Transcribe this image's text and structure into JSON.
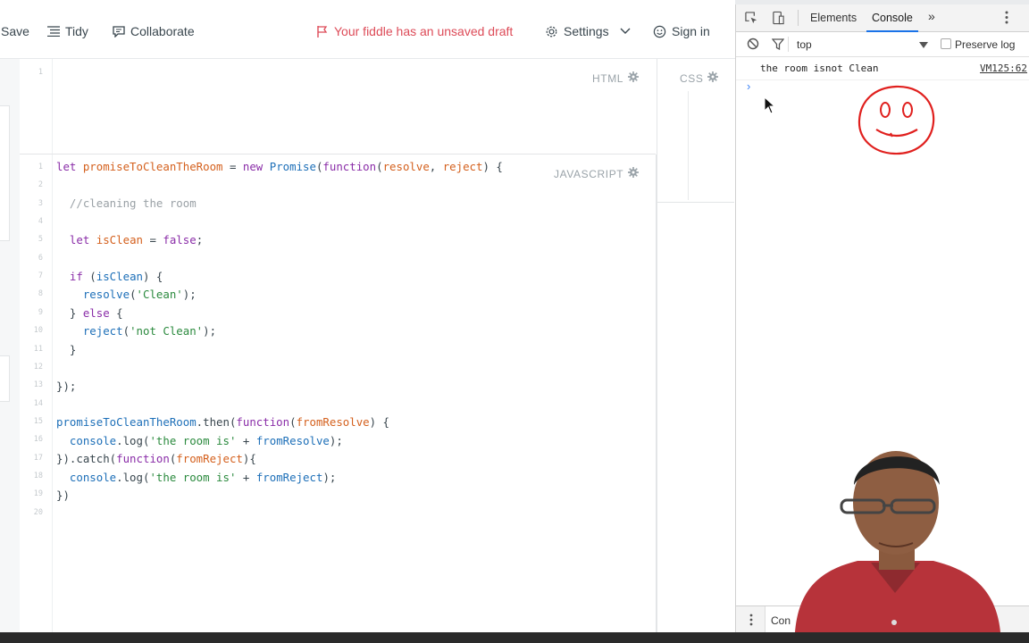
{
  "toolbar": {
    "save": "Save",
    "tidy": "Tidy",
    "collaborate": "Collaborate",
    "draft_notice": "Your fiddle has an unsaved draft",
    "settings": "Settings",
    "sign_in": "Sign in"
  },
  "panes": {
    "html_label": "HTML",
    "css_label": "CSS",
    "js_label": "JAVASCRIPT",
    "html_line_number": "1"
  },
  "code": {
    "line_numbers": [
      "1",
      "2",
      "3",
      "4",
      "5",
      "6",
      "7",
      "8",
      "9",
      "10",
      "11",
      "12",
      "13",
      "14",
      "15",
      "16",
      "17",
      "18",
      "19",
      "20"
    ]
  },
  "devtools": {
    "tabs": [
      "Elements",
      "Console"
    ],
    "more_tabs": "»",
    "context": "top",
    "preserve_log": "Preserve log",
    "message": "the room isnot Clean",
    "message_source": "VM125:62",
    "prompt": "›",
    "drawer_tab": "Con"
  },
  "colors": {
    "draft_red": "#dd4b58",
    "keyword_purple": "#8a2da8",
    "function_blue": "#1d6fb8",
    "param_orange": "#d4601d",
    "string_green": "#2b8a3e",
    "devtools_blue": "#1a73e8",
    "sketch_red": "#e0201e"
  },
  "icons": {
    "tidy": "lines-icon",
    "collaborate": "chat-icon",
    "draft": "flag-icon",
    "settings": "gear-icon",
    "sign_in": "smiley-icon",
    "devtools_inspect": "inspect-icon",
    "devtools_device": "device-icon",
    "clear": "clear-icon",
    "filter": "filter-icon",
    "annotation": "smiley-face-drawing"
  }
}
